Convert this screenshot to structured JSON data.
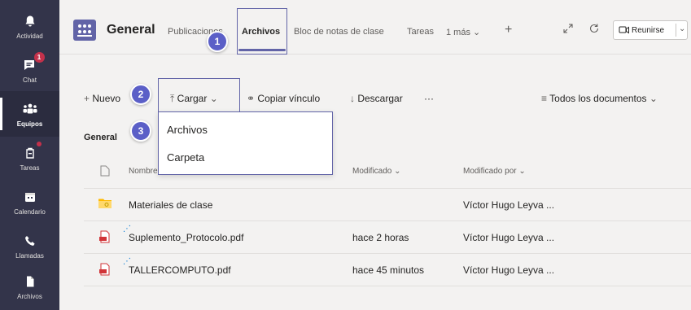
{
  "rail": {
    "items": [
      {
        "label": "Actividad",
        "icon": "bell-icon"
      },
      {
        "label": "Chat",
        "icon": "chat-icon",
        "badge": "1"
      },
      {
        "label": "Equipos",
        "icon": "teams-icon"
      },
      {
        "label": "Tareas",
        "icon": "assignments-icon"
      },
      {
        "label": "Calendario",
        "icon": "calendar-icon"
      },
      {
        "label": "Llamadas",
        "icon": "phone-icon"
      },
      {
        "label": "Archivos",
        "icon": "file-icon"
      }
    ]
  },
  "header": {
    "channel": "General",
    "tabs": {
      "publicaciones": "Publicaciones",
      "archivos": "Archivos",
      "bloc": "Bloc de notas de clase",
      "tareas": "Tareas",
      "mas": "1 más",
      "add": "+"
    },
    "reunirse": "Reunirse"
  },
  "toolbar": {
    "nuevo": "Nuevo",
    "cargar": "Cargar",
    "copiar": "Copiar vínculo",
    "descargar": "Descargar",
    "more": "···",
    "view": "Todos los documentos"
  },
  "breadcrumb": "General",
  "dropdown": {
    "items": [
      "Archivos",
      "Carpeta"
    ]
  },
  "table": {
    "headers": {
      "name": "Nombre",
      "modified": "Modificado",
      "modified_by": "Modificado por"
    },
    "rows": [
      {
        "name": "Materiales de clase",
        "modified": "",
        "modified_by": "Víctor Hugo Leyva ...",
        "type": "folder"
      },
      {
        "name": "Suplemento_Protocolo.pdf",
        "modified": "hace 2 horas",
        "modified_by": "Víctor Hugo Leyva ...",
        "type": "pdf"
      },
      {
        "name": "TALLERCOMPUTO.pdf",
        "modified": "hace 45 minutos",
        "modified_by": "Víctor Hugo Leyva ...",
        "type": "pdf"
      }
    ]
  },
  "callouts": [
    "1",
    "2",
    "3"
  ],
  "colors": {
    "accent": "#6264a7",
    "rail": "#33344a",
    "badge": "#c4314b",
    "callout": "#5b5fc7"
  }
}
